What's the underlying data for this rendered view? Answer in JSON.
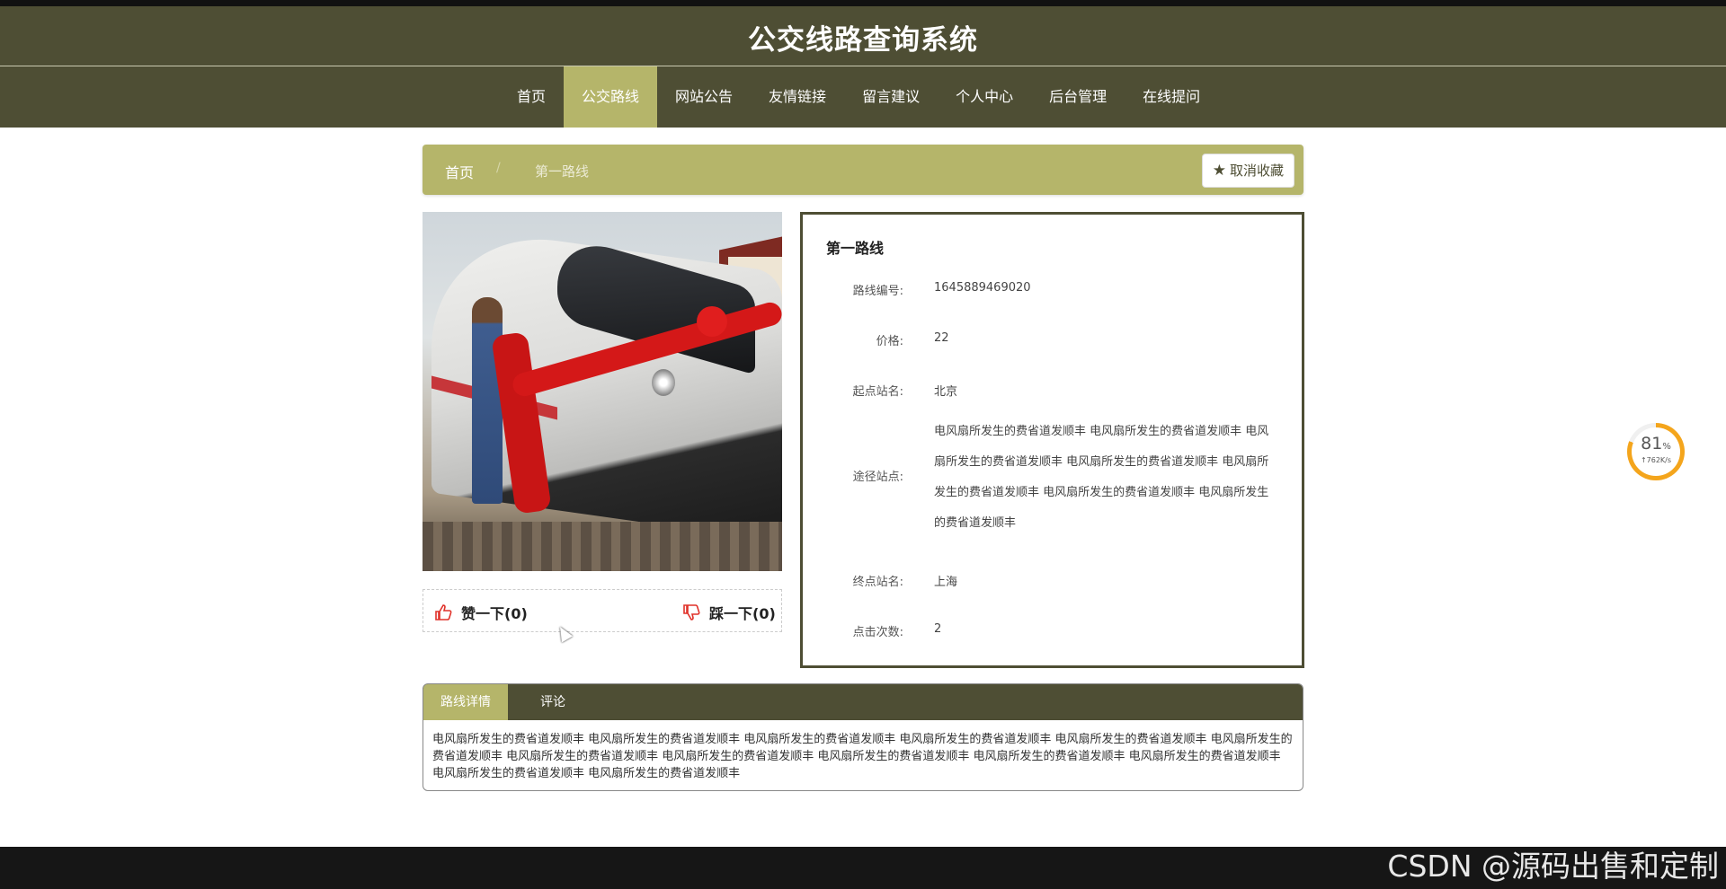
{
  "header": {
    "title": "公交线路查询系统"
  },
  "nav": {
    "items": [
      {
        "label": "首页"
      },
      {
        "label": "公交路线"
      },
      {
        "label": "网站公告"
      },
      {
        "label": "友情链接"
      },
      {
        "label": "留言建议"
      },
      {
        "label": "个人中心"
      },
      {
        "label": "后台管理"
      },
      {
        "label": "在线提问"
      }
    ],
    "active_index": 1
  },
  "breadcrumb": {
    "home": "首页",
    "separator": "/",
    "current": "第一路线"
  },
  "favorite_button": {
    "label": "取消收藏",
    "icon": "star-icon"
  },
  "votes": {
    "up": {
      "label": "赞一下(0)",
      "icon": "thumbs-up-icon"
    },
    "down": {
      "label": "踩一下(0)",
      "icon": "thumbs-down-icon"
    }
  },
  "detail": {
    "title": "第一路线",
    "fields": {
      "route_no": {
        "label": "路线编号:",
        "value": "1645889469020"
      },
      "price": {
        "label": "价格:",
        "value": "22"
      },
      "start": {
        "label": "起点站名:",
        "value": "北京"
      },
      "via": {
        "label": "途径站点:",
        "value": "电风扇所发生的费省道发顺丰 电风扇所发生的费省道发顺丰 电风扇所发生的费省道发顺丰 电风扇所发生的费省道发顺丰 电风扇所发生的费省道发顺丰 电风扇所发生的费省道发顺丰 电风扇所发生的费省道发顺丰"
      },
      "end": {
        "label": "终点站名:",
        "value": "上海"
      },
      "clicks": {
        "label": "点击次数:",
        "value": "2"
      }
    }
  },
  "tabs": {
    "items": [
      {
        "label": "路线详情"
      },
      {
        "label": "评论"
      }
    ],
    "content": "电风扇所发生的费省道发顺丰 电风扇所发生的费省道发顺丰 电风扇所发生的费省道发顺丰 电风扇所发生的费省道发顺丰 电风扇所发生的费省道发顺丰 电风扇所发生的费省道发顺丰 电风扇所发生的费省道发顺丰 电风扇所发生的费省道发顺丰 电风扇所发生的费省道发顺丰 电风扇所发生的费省道发顺丰 电风扇所发生的费省道发顺丰 电风扇所发生的费省道发顺丰 电风扇所发生的费省道发顺丰"
  },
  "speed_widget": {
    "percent": "81",
    "unit": "%",
    "rate": "↑762K/s"
  },
  "watermark": "CSDN @源码出售和定制",
  "colors": {
    "primary": "#4e4e34",
    "accent": "#b5b56a",
    "vote_icon": "#e0322a",
    "widget": "#f4a51c"
  }
}
